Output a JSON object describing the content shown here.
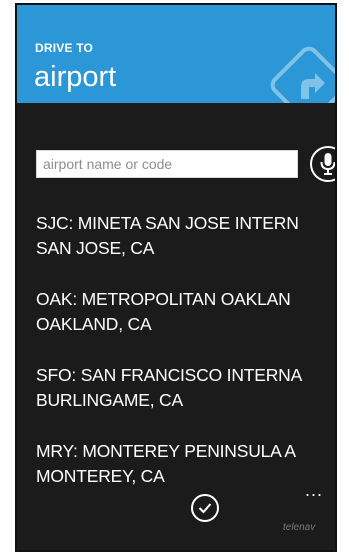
{
  "header": {
    "eyebrow": "DRIVE TO",
    "title": "airport",
    "logo_icon": "telenav-navigation-logo",
    "color": "#2b97d6"
  },
  "search": {
    "placeholder": "airport name or code",
    "value": "",
    "mic_icon": "microphone-icon"
  },
  "results": [
    {
      "line1": "SJC: MINETA SAN JOSE INTERN",
      "line2": "SAN JOSE, CA"
    },
    {
      "line1": "OAK: METROPOLITAN OAKLAN",
      "line2": "OAKLAND, CA"
    },
    {
      "line1": "SFO: SAN FRANCISCO INTERNA",
      "line2": "BURLINGAME, CA"
    },
    {
      "line1": "MRY: MONTEREY PENINSULA A",
      "line2": "MONTEREY, CA"
    }
  ],
  "appbar": {
    "ok_icon": "checkmark-icon",
    "more_label": "...",
    "brand": "telenav"
  }
}
